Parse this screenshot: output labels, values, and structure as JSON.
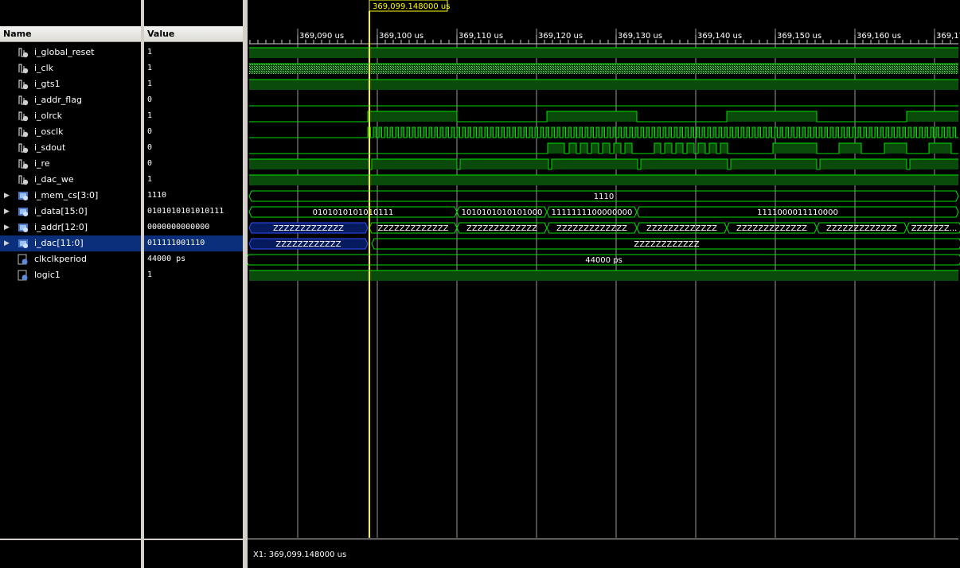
{
  "columns": {
    "name": "Name",
    "value": "Value"
  },
  "cursor": {
    "label": "369,099.148000 us",
    "status": "X1: 369,099.148000 us"
  },
  "ruler_ticks": [
    "369,090 us",
    "369,100 us",
    "369,110 us",
    "369,120 us",
    "369,130 us",
    "369,140 us",
    "369,150 us",
    "369,160 us",
    "369,17"
  ],
  "signals": [
    {
      "name": "i_global_reset",
      "value": "1",
      "kind": "bit",
      "expandable": false
    },
    {
      "name": "i_clk",
      "value": "1",
      "kind": "bit",
      "expandable": false
    },
    {
      "name": "i_gts1",
      "value": "1",
      "kind": "bit",
      "expandable": false
    },
    {
      "name": "i_addr_flag",
      "value": "0",
      "kind": "bit",
      "expandable": false
    },
    {
      "name": "i_olrck",
      "value": "1",
      "kind": "bit",
      "expandable": false
    },
    {
      "name": "i_osclk",
      "value": "0",
      "kind": "bit",
      "expandable": false
    },
    {
      "name": "i_sdout",
      "value": "0",
      "kind": "bit",
      "expandable": false
    },
    {
      "name": "i_re",
      "value": "0",
      "kind": "bit",
      "expandable": false
    },
    {
      "name": "i_dac_we",
      "value": "1",
      "kind": "bit",
      "expandable": false
    },
    {
      "name": "i_mem_cs[3:0]",
      "value": "1110",
      "kind": "bus",
      "expandable": true
    },
    {
      "name": "i_data[15:0]",
      "value": "0101010101010111",
      "kind": "bus",
      "expandable": true
    },
    {
      "name": "i_addr[12:0]",
      "value": "0000000000000",
      "kind": "bus",
      "expandable": true
    },
    {
      "name": "i_dac[11:0]",
      "value": "011111001110",
      "kind": "bus",
      "expandable": true,
      "selected": true
    },
    {
      "name": "clkclkperiod",
      "value": "44000 ps",
      "kind": "param",
      "expandable": false
    },
    {
      "name": "logic1",
      "value": "1",
      "kind": "param",
      "expandable": false
    }
  ],
  "bus_labels": {
    "mem_cs": [
      "1110"
    ],
    "data": [
      "0101010101010111",
      "1010101010101000",
      "1111111100000000",
      "1111000011110000"
    ],
    "addr": [
      "ZZZZZZZZZZZZZ",
      "ZZZZZZZZZZZZZ",
      "ZZZZZZZZZZZZZ",
      "ZZZZZZZZZZZZZ",
      "ZZZZZZZZZZZZZ",
      "ZZZZZZZZZZZZZ",
      "ZZZZZZZZZZZZZ",
      "ZZZZZZZ..."
    ],
    "dac": [
      "ZZZZZZZZZZZZ",
      "ZZZZZZZZZZZZ"
    ],
    "clkclkperiod": [
      "44000 ps"
    ]
  },
  "colors": {
    "wave": "#00e000",
    "fill": "#0a4a0a",
    "cursor": "#ffff00",
    "selected": "#0b2f7a",
    "grid": "#9a9a9a",
    "zbus": "#2f4fff"
  }
}
